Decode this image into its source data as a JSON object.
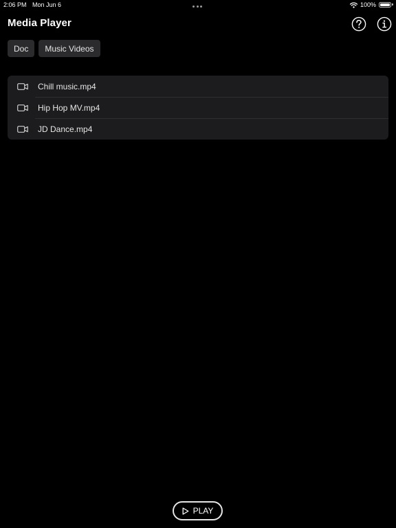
{
  "status_bar": {
    "time": "2:06 PM",
    "date": "Mon Jun 6",
    "battery": "100%",
    "icons": [
      "wifi-icon",
      "battery-icon"
    ]
  },
  "header": {
    "title": "Media Player",
    "help_icon": "question-circle-icon",
    "info_icon": "info-circle-icon"
  },
  "tabs": [
    {
      "label": "Doc"
    },
    {
      "label": "Music Videos"
    }
  ],
  "files": [
    {
      "name": "Chill music.mp4",
      "icon": "video-camera-icon"
    },
    {
      "name": "Hip Hop MV.mp4",
      "icon": "video-camera-icon"
    },
    {
      "name": "JD Dance.mp4",
      "icon": "video-camera-icon"
    }
  ],
  "play_button": {
    "label": "PLAY",
    "icon": "play-icon"
  },
  "colors": {
    "background": "#000000",
    "list_background": "#1c1c1e",
    "tab_background": "#2b2b2d",
    "text": "#ffffff"
  }
}
